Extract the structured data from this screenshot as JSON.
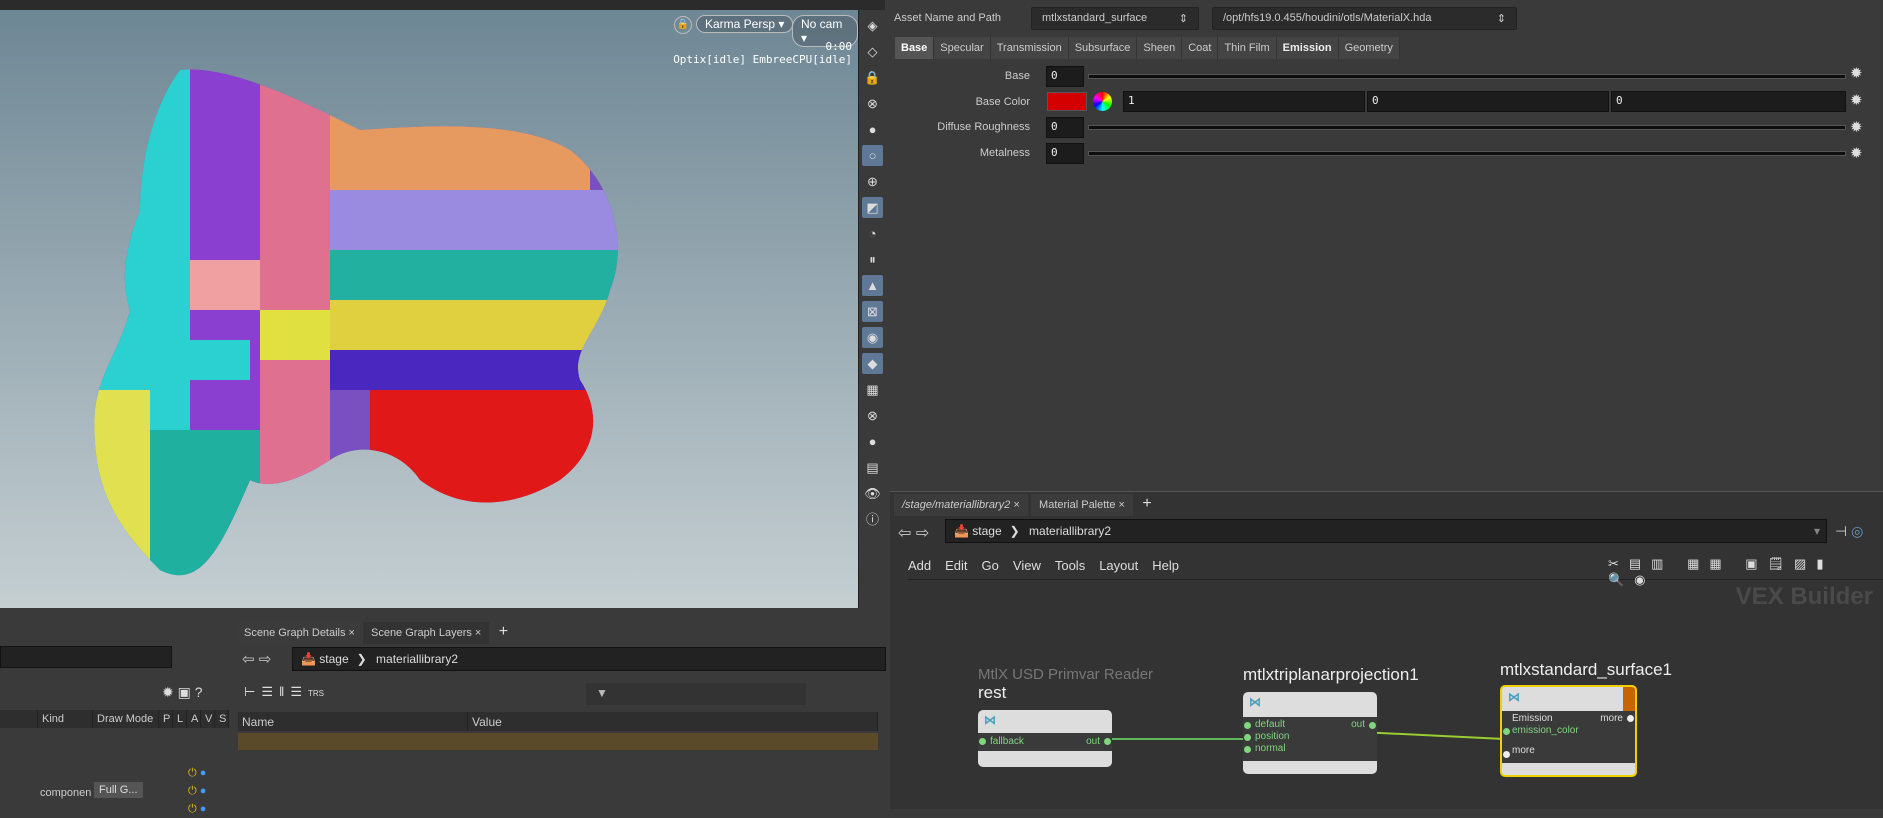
{
  "viewport": {
    "renderer_label": "Karma  Persp",
    "camera_label": "No cam",
    "time": "0:00",
    "status": "Optix[idle] EmbreeCPU[idle]"
  },
  "params": {
    "asset_label": "Asset Name and Path",
    "asset_name": "mtlxstandard_surface",
    "asset_path": "/opt/hfs19.0.455/houdini/otls/MaterialX.hda",
    "tabs": [
      "Base",
      "Specular",
      "Transmission",
      "Subsurface",
      "Sheen",
      "Coat",
      "Thin Film",
      "Emission",
      "Geometry"
    ],
    "active_tab": "Base",
    "rows": [
      {
        "label": "Base",
        "value": "0"
      },
      {
        "label": "Base Color",
        "r": "1",
        "g": "0",
        "b": "0",
        "swatch": "#d40000"
      },
      {
        "label": "Diffuse Roughness",
        "value": "0"
      },
      {
        "label": "Metalness",
        "value": "0"
      }
    ]
  },
  "network": {
    "tabs": [
      {
        "label": "/stage/materiallibrary2"
      },
      {
        "label": "Material Palette"
      }
    ],
    "path": [
      "stage",
      "materiallibrary2"
    ],
    "menu": [
      "Add",
      "Edit",
      "Go",
      "View",
      "Tools",
      "Layout",
      "Help"
    ],
    "context_label": "VEX Builder",
    "nodes": [
      {
        "type_label": "MtlX USD Primvar Reader",
        "name": "rest",
        "inputs": [
          "fallback"
        ],
        "outputs": [
          "out"
        ]
      },
      {
        "name": "mtlxtriplanarprojection1",
        "inputs": [
          "default",
          "position",
          "normal"
        ],
        "outputs": [
          "out"
        ]
      },
      {
        "name": "mtlxstandard_surface1",
        "group": "Emission",
        "inputs": [
          "emission_color",
          "more"
        ],
        "outputs": [
          "more"
        ]
      }
    ]
  },
  "scene_graph_tree": {
    "columns": [
      "Kind",
      "Draw Mode",
      "P",
      "L",
      "A",
      "V",
      "S"
    ],
    "row_kind": "componen",
    "row_draw_mode": "Full G..."
  },
  "scene_graph_details": {
    "tabs": [
      "Scene Graph Details",
      "Scene Graph Layers"
    ],
    "path": [
      "stage",
      "materiallibrary2"
    ],
    "columns": [
      "Name",
      "Value"
    ],
    "toolbar_label": "TRS"
  }
}
